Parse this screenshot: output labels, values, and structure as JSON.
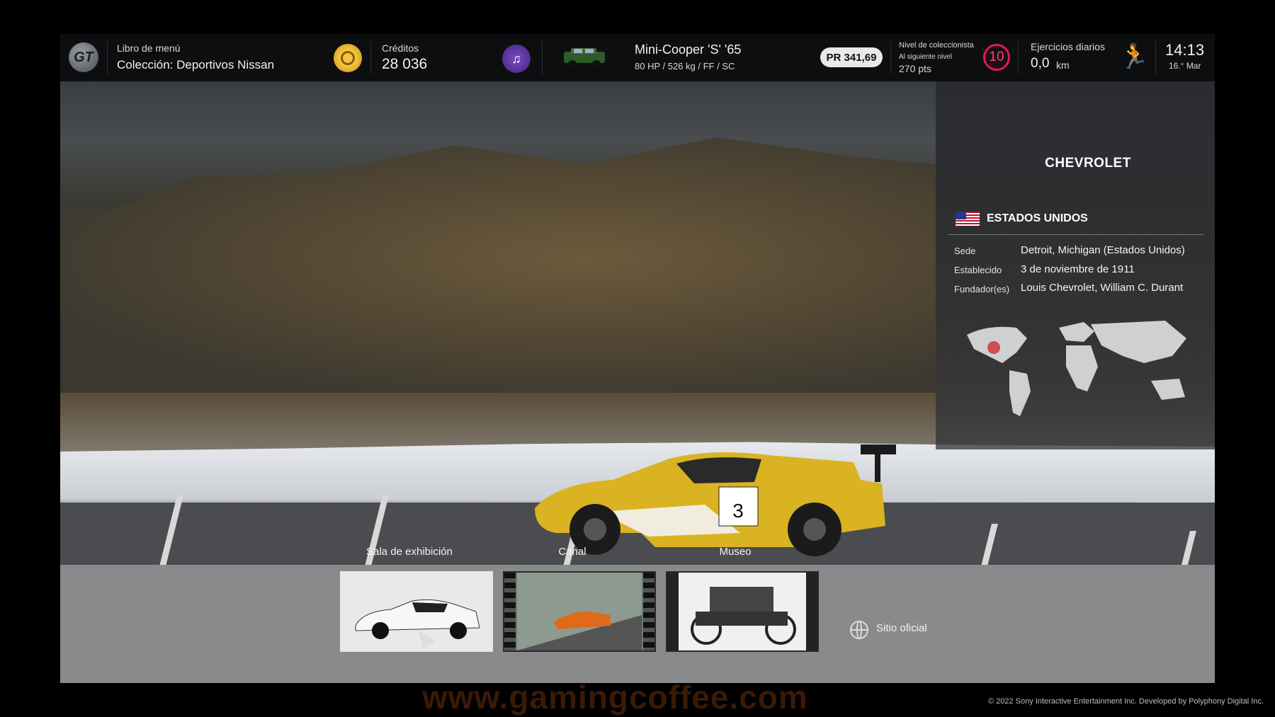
{
  "topbar": {
    "menu_book_label": "Libro de menú",
    "menu_book_value": "Colección: Deportivos Nissan",
    "credits_label": "Créditos",
    "credits_value": "28 036",
    "car_name": "Mini-Cooper 'S' '65",
    "car_specs": "80 HP / 526 kg / FF / SC",
    "pr_value": "PR 341,69",
    "collector_level_label": "Nivel de coleccionista",
    "next_level_label": "Al siguiente nivel",
    "next_level_points": "270 pts",
    "collector_level": "10",
    "daily_workout_label": "Ejercicios diarios",
    "daily_distance": "0,0",
    "distance_unit": "km",
    "time": "14:13",
    "date": "16.° Mar"
  },
  "brand": {
    "name": "CHEVROLET",
    "country": "ESTADOS UNIDOS",
    "info": [
      {
        "label": "Sede",
        "value": "Detroit, Michigan (Estados Unidos)"
      },
      {
        "label": "Establecido",
        "value": "3 de noviembre de 1911"
      },
      {
        "label": "Fundador(es)",
        "value": "Louis Chevrolet, William C. Durant"
      }
    ]
  },
  "menu": {
    "tiles": [
      {
        "label": "Sala de exhibición",
        "selected": true
      },
      {
        "label": "Canal",
        "selected": false
      },
      {
        "label": "Museo",
        "selected": false
      }
    ],
    "official_site": "Sitio oficial"
  },
  "icons": [
    "gt-logo-icon",
    "credits-coin-icon",
    "music-icon",
    "runner-icon",
    "globe-icon",
    "us-flag-icon",
    "chevrolet-bowtie-icon"
  ],
  "colors": {
    "accent_level": "#e8155a",
    "credits_gold": "#f5c542",
    "car_yellow": "#d9b321"
  },
  "footer": {
    "watermark": "www.gamingcoffee.com",
    "copyright": "© 2022 Sony Interactive Entertainment Inc. Developed by Polyphony Digital Inc."
  }
}
